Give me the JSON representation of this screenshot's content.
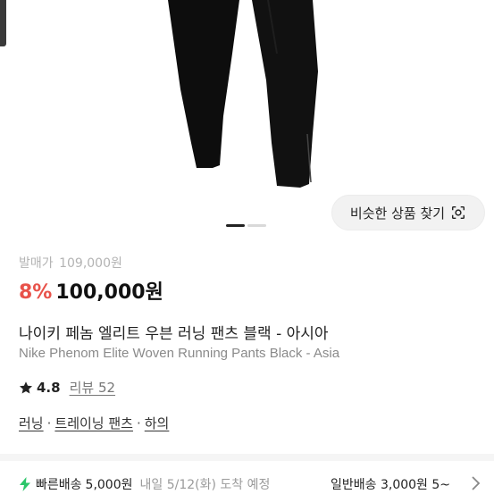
{
  "product": {
    "original_price_label": "발매가",
    "original_price": "109,000원",
    "discount": "8%",
    "price": "100,000원",
    "title_ko": "나이키 페놈 엘리트 우븐 러닝 팬츠 블랙 - 아시아",
    "title_en": "Nike Phenom Elite Woven Running Pants Black - Asia",
    "rating": "4.8",
    "reviews": "리뷰 52"
  },
  "actions": {
    "similar_label": "비슷한 상품 찾기"
  },
  "carousel": {
    "total": 2,
    "active": 1
  },
  "categories": [
    "러닝",
    "트레이닝 팬츠",
    "하의"
  ],
  "shipping": {
    "fast_name": "빠른배송",
    "fast_price": "5,000원",
    "fast_eta": "내일 5/12(화) 도착 예정",
    "normal_text": "일반배송 3,000원 5~"
  },
  "colors": {
    "accent_red": "#e8524a",
    "bolt_green": "#2cc66a"
  },
  "icons": [
    "search-lens-icon",
    "star-icon",
    "bolt-icon",
    "chevron-right-icon"
  ]
}
